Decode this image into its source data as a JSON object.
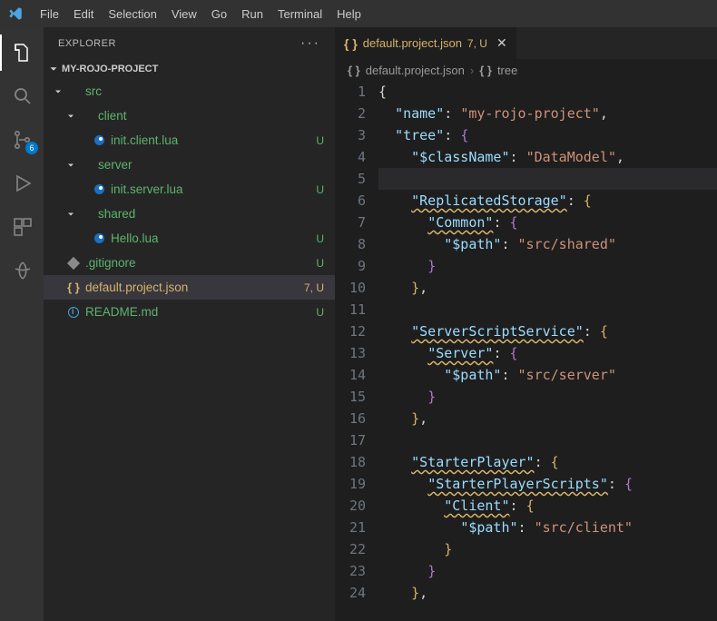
{
  "menu": {
    "items": [
      "File",
      "Edit",
      "Selection",
      "View",
      "Go",
      "Run",
      "Terminal",
      "Help"
    ]
  },
  "activity": {
    "items": [
      {
        "name": "files-icon",
        "active": true,
        "badge": null
      },
      {
        "name": "search-icon",
        "active": false,
        "badge": null
      },
      {
        "name": "source-control-icon",
        "active": false,
        "badge": "6"
      },
      {
        "name": "run-debug-icon",
        "active": false,
        "badge": null
      },
      {
        "name": "extensions-icon",
        "active": false,
        "badge": null
      },
      {
        "name": "live-share-icon",
        "active": false,
        "badge": null
      }
    ]
  },
  "explorer": {
    "title": "EXPLORER",
    "project": "MY-ROJO-PROJECT",
    "rows": [
      {
        "indent": 0,
        "kind": "folder",
        "open": true,
        "label": "src",
        "git": "u",
        "decor": "dot"
      },
      {
        "indent": 1,
        "kind": "folder",
        "open": true,
        "label": "client",
        "git": "u",
        "decor": "dot"
      },
      {
        "indent": 2,
        "kind": "lua",
        "label": "init.client.lua",
        "git": "u",
        "decor": "U"
      },
      {
        "indent": 1,
        "kind": "folder",
        "open": true,
        "label": "server",
        "git": "u",
        "decor": "dot"
      },
      {
        "indent": 2,
        "kind": "lua",
        "label": "init.server.lua",
        "git": "u",
        "decor": "U"
      },
      {
        "indent": 1,
        "kind": "folder",
        "open": true,
        "label": "shared",
        "git": "u",
        "decor": "dot"
      },
      {
        "indent": 2,
        "kind": "lua",
        "label": "Hello.lua",
        "git": "u",
        "decor": "U"
      },
      {
        "indent": 0,
        "kind": "gitignore",
        "label": ".gitignore",
        "git": "u",
        "decor": "U"
      },
      {
        "indent": 0,
        "kind": "json",
        "label": "default.project.json",
        "git": "m",
        "decor": "7, U",
        "selected": true
      },
      {
        "indent": 0,
        "kind": "readme",
        "label": "README.md",
        "git": "u",
        "decor": "U"
      }
    ]
  },
  "tab": {
    "icon": "braces-icon",
    "label": "default.project.json",
    "decor": "7, U"
  },
  "breadcrumb": {
    "segments": [
      {
        "icon": "braces-icon",
        "text": "default.project.json"
      },
      {
        "icon": "braces-icon",
        "text": "tree"
      }
    ]
  },
  "editor": {
    "highlight_line": 5,
    "lines": [
      {
        "n": 1,
        "tokens": [
          [
            "pun",
            "{"
          ]
        ]
      },
      {
        "n": 2,
        "tokens": [
          [
            "pun",
            "  "
          ],
          [
            "key",
            "\"name\""
          ],
          [
            "pun",
            ": "
          ],
          [
            "str",
            "\"my-rojo-project\""
          ],
          [
            "pun",
            ","
          ]
        ]
      },
      {
        "n": 3,
        "tokens": [
          [
            "pun",
            "  "
          ],
          [
            "key",
            "\"tree\""
          ],
          [
            "pun",
            ": "
          ],
          [
            "brace",
            "{"
          ]
        ]
      },
      {
        "n": 4,
        "tokens": [
          [
            "pun",
            "    "
          ],
          [
            "key",
            "\"$className\""
          ],
          [
            "pun",
            ": "
          ],
          [
            "str",
            "\"DataModel\""
          ],
          [
            "pun",
            ","
          ]
        ]
      },
      {
        "n": 5,
        "tokens": []
      },
      {
        "n": 6,
        "tokens": [
          [
            "pun",
            "    "
          ],
          [
            "keyu",
            "\"ReplicatedStorage\""
          ],
          [
            "pun",
            ": "
          ],
          [
            "brace2",
            "{"
          ]
        ]
      },
      {
        "n": 7,
        "tokens": [
          [
            "pun",
            "      "
          ],
          [
            "keyu",
            "\"Common\""
          ],
          [
            "pun",
            ": "
          ],
          [
            "brace",
            "{"
          ]
        ]
      },
      {
        "n": 8,
        "tokens": [
          [
            "pun",
            "        "
          ],
          [
            "key",
            "\"$path\""
          ],
          [
            "pun",
            ": "
          ],
          [
            "str",
            "\"src/shared\""
          ]
        ]
      },
      {
        "n": 9,
        "tokens": [
          [
            "pun",
            "      "
          ],
          [
            "brace",
            "}"
          ]
        ]
      },
      {
        "n": 10,
        "tokens": [
          [
            "pun",
            "    "
          ],
          [
            "brace2",
            "}"
          ],
          [
            "pun",
            ","
          ]
        ]
      },
      {
        "n": 11,
        "tokens": []
      },
      {
        "n": 12,
        "tokens": [
          [
            "pun",
            "    "
          ],
          [
            "keyu",
            "\"ServerScriptService\""
          ],
          [
            "pun",
            ": "
          ],
          [
            "brace2",
            "{"
          ]
        ]
      },
      {
        "n": 13,
        "tokens": [
          [
            "pun",
            "      "
          ],
          [
            "keyu",
            "\"Server\""
          ],
          [
            "pun",
            ": "
          ],
          [
            "brace",
            "{"
          ]
        ]
      },
      {
        "n": 14,
        "tokens": [
          [
            "pun",
            "        "
          ],
          [
            "key",
            "\"$path\""
          ],
          [
            "pun",
            ": "
          ],
          [
            "str",
            "\"src/server\""
          ]
        ]
      },
      {
        "n": 15,
        "tokens": [
          [
            "pun",
            "      "
          ],
          [
            "brace",
            "}"
          ]
        ]
      },
      {
        "n": 16,
        "tokens": [
          [
            "pun",
            "    "
          ],
          [
            "brace2",
            "}"
          ],
          [
            "pun",
            ","
          ]
        ]
      },
      {
        "n": 17,
        "tokens": []
      },
      {
        "n": 18,
        "tokens": [
          [
            "pun",
            "    "
          ],
          [
            "keyu",
            "\"StarterPlayer\""
          ],
          [
            "pun",
            ": "
          ],
          [
            "brace2",
            "{"
          ]
        ]
      },
      {
        "n": 19,
        "tokens": [
          [
            "pun",
            "      "
          ],
          [
            "keyu",
            "\"StarterPlayerScripts\""
          ],
          [
            "pun",
            ": "
          ],
          [
            "brace",
            "{"
          ]
        ]
      },
      {
        "n": 20,
        "tokens": [
          [
            "pun",
            "        "
          ],
          [
            "keyu",
            "\"Client\""
          ],
          [
            "pun",
            ": "
          ],
          [
            "brace2",
            "{"
          ]
        ]
      },
      {
        "n": 21,
        "tokens": [
          [
            "pun",
            "          "
          ],
          [
            "key",
            "\"$path\""
          ],
          [
            "pun",
            ": "
          ],
          [
            "str",
            "\"src/client\""
          ]
        ]
      },
      {
        "n": 22,
        "tokens": [
          [
            "pun",
            "        "
          ],
          [
            "brace2",
            "}"
          ]
        ]
      },
      {
        "n": 23,
        "tokens": [
          [
            "pun",
            "      "
          ],
          [
            "brace",
            "}"
          ]
        ]
      },
      {
        "n": 24,
        "tokens": [
          [
            "pun",
            "    "
          ],
          [
            "brace2",
            "}"
          ],
          [
            "pun",
            ","
          ]
        ]
      }
    ]
  }
}
